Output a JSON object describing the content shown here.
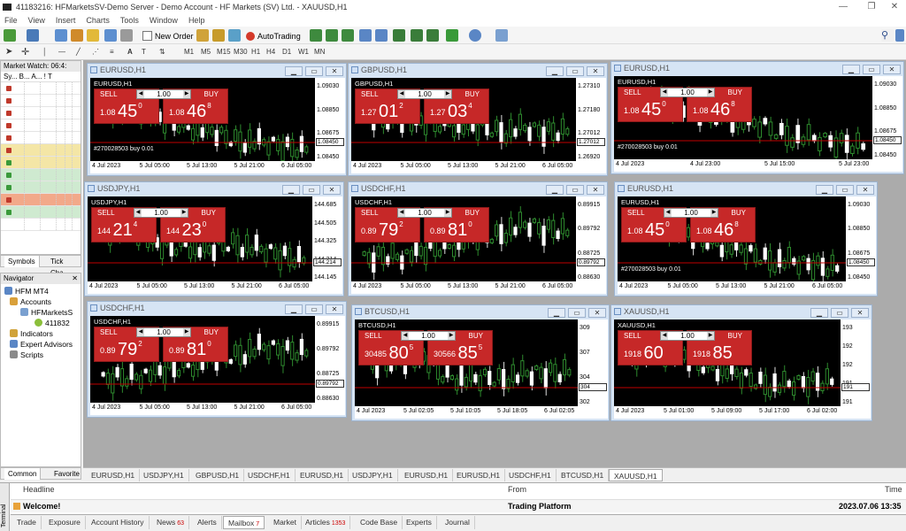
{
  "window": {
    "title": "41183216: HFMarketsSV-Demo Server - Demo Account - HF Markets (SV) Ltd. - XAUUSD,H1"
  },
  "menu": [
    "File",
    "View",
    "Insert",
    "Charts",
    "Tools",
    "Window",
    "Help"
  ],
  "toolbar": {
    "new_order": "New Order",
    "autotrading": "AutoTrading",
    "timeframes": [
      "M1",
      "M5",
      "M15",
      "M30",
      "H1",
      "H4",
      "D1",
      "W1",
      "MN"
    ]
  },
  "market_watch": {
    "title": "Market Watch: 06:4:",
    "columns": "Sy...  B...  A...  !  T",
    "rows": 12,
    "tabs": [
      "Symbols",
      "Tick Cha"
    ]
  },
  "navigator": {
    "title": "Navigator",
    "items": [
      "HFM MT4",
      "Accounts",
      "HFMarketsS",
      "411832",
      "Indicators",
      "Expert Advisors",
      "Scripts"
    ],
    "tabs": [
      "Common",
      "Favorite"
    ]
  },
  "colors": {
    "sell": "#c62828",
    "bg_chart": "#000000",
    "bull": "#2e8b2e",
    "bear": "#ffffff",
    "price_line": "#c00000"
  },
  "charts": [
    {
      "title": "EURUSD,H1",
      "sym": "EURUSD,H1",
      "lot": "1.00",
      "sell_small": "1.08",
      "sell_big": "45",
      "sell_sup": "0",
      "buy_small": "1.08",
      "buy_big": "46",
      "buy_sup": "8",
      "prices": [
        "1.09030",
        "1.08850",
        "1.08675",
        "1.08450"
      ],
      "current": "1.08450",
      "order": "#270028503 buy 0.01",
      "times": [
        "4 Jul 2023",
        "5 Jul 05:00",
        "5 Jul 13:00",
        "5 Jul 21:00",
        "6 Jul 05:00"
      ]
    },
    {
      "title": "GBPUSD,H1",
      "sym": "GBPUSD,H1",
      "lot": "1.00",
      "sell_small": "1.27",
      "sell_big": "01",
      "sell_sup": "2",
      "buy_small": "1.27",
      "buy_big": "03",
      "buy_sup": "4",
      "prices": [
        "1.27310",
        "1.27180",
        "1.27012",
        "1.26920"
      ],
      "current": "1.27012",
      "order": "",
      "times": [
        "4 Jul 2023",
        "5 Jul 05:00",
        "5 Jul 13:00",
        "5 Jul 21:00",
        "6 Jul 05:00"
      ]
    },
    {
      "title": "EURUSD,H1",
      "sym": "EURUSD,H1",
      "lot": "1.00",
      "sell_small": "1.08",
      "sell_big": "45",
      "sell_sup": "0",
      "buy_small": "1.08",
      "buy_big": "46",
      "buy_sup": "8",
      "prices": [
        "1.09030",
        "1.08850",
        "1.08675",
        "1.08450"
      ],
      "current": "1.08450",
      "order": "#270028503 buy 0.01",
      "times": [
        "4 Jul 2023",
        "4 Jul 23:00",
        "5 Jul 15:00",
        "5 Jul 23:00"
      ]
    },
    {
      "title": "USDJPY,H1",
      "sym": "USDJPY,H1",
      "lot": "1.00",
      "sell_small": "144",
      "sell_big": "21",
      "sell_sup": "4",
      "buy_small": "144",
      "buy_big": "23",
      "buy_sup": "0",
      "prices": [
        "144.685",
        "144.505",
        "144.325",
        "144.214",
        "144.145"
      ],
      "current": "144.214",
      "order": "",
      "times": [
        "4 Jul 2023",
        "5 Jul 05:00",
        "5 Jul 13:00",
        "5 Jul 21:00",
        "6 Jul 05:00"
      ]
    },
    {
      "title": "USDCHF,H1",
      "sym": "USDCHF,H1",
      "lot": "1.00",
      "sell_small": "0.89",
      "sell_big": "79",
      "sell_sup": "2",
      "buy_small": "0.89",
      "buy_big": "81",
      "buy_sup": "0",
      "prices": [
        "0.89915",
        "0.89792",
        "0.88725",
        "0.88630"
      ],
      "current": "0.89792",
      "order": "",
      "times": [
        "4 Jul 2023",
        "5 Jul 05:00",
        "5 Jul 13:00",
        "5 Jul 21:00",
        "6 Jul 05:00"
      ]
    },
    {
      "title": "EURUSD,H1",
      "sym": "EURUSD,H1",
      "lot": "1.00",
      "sell_small": "1.08",
      "sell_big": "45",
      "sell_sup": "0",
      "buy_small": "1.08",
      "buy_big": "46",
      "buy_sup": "8",
      "prices": [
        "1.09030",
        "1.08850",
        "1.08675",
        "1.08450"
      ],
      "current": "1.08450",
      "order": "#270028503 buy 0.01",
      "times": [
        "4 Jul 2023",
        "5 Jul 05:00",
        "5 Jul 13:00",
        "5 Jul 21:00",
        "6 Jul 05:00"
      ]
    },
    {
      "title": "USDCHF,H1",
      "sym": "USDCHF,H1",
      "lot": "1.00",
      "sell_small": "0.89",
      "sell_big": "79",
      "sell_sup": "2",
      "buy_small": "0.89",
      "buy_big": "81",
      "buy_sup": "0",
      "prices": [
        "0.89915",
        "0.89792",
        "0.88725",
        "0.88630"
      ],
      "current": "0.89792",
      "order": "",
      "times": [
        "4 Jul 2023",
        "5 Jul 05:00",
        "5 Jul 13:00",
        "5 Jul 21:00",
        "6 Jul 05:00"
      ]
    },
    {
      "title": "BTCUSD,H1",
      "sym": "BTCUSD,H1",
      "lot": "1.00",
      "sell_small": "30485",
      "sell_big": "80",
      "sell_sup": "5",
      "buy_small": "30566",
      "buy_big": "85",
      "buy_sup": "5",
      "prices": [
        "309",
        "307",
        "304",
        "302"
      ],
      "current": "304",
      "order": "",
      "times": [
        "4 Jul 2023",
        "5 Jul 02:05",
        "5 Jul 10:05",
        "5 Jul 18:05",
        "6 Jul 02:05"
      ]
    },
    {
      "title": "XAUUSD,H1",
      "sym": "XAUUSD,H1",
      "lot": "1.00",
      "sell_small": "1918",
      "sell_big": "60",
      "sell_sup": "",
      "buy_small": "1918",
      "buy_big": "85",
      "buy_sup": "",
      "prices": [
        "193",
        "192",
        "192",
        "191",
        "191"
      ],
      "current": "191",
      "order": "",
      "times": [
        "4 Jul 2023",
        "5 Jul 01:00",
        "5 Jul 09:00",
        "5 Jul 17:00",
        "6 Jul 02:00"
      ]
    }
  ],
  "chart_tabs": [
    "EURUSD,H1",
    "USDJPY,H1",
    "GBPUSD,H1",
    "USDCHF,H1",
    "EURUSD,H1",
    "USDJPY,H1",
    "EURUSD,H1",
    "EURUSD,H1",
    "USDCHF,H1",
    "BTCUSD,H1",
    "XAUUSD,H1"
  ],
  "terminal": {
    "label": "Terminal",
    "headers": {
      "headline": "Headline",
      "from": "From",
      "time": "Time"
    },
    "news": {
      "headline": "Welcome!",
      "from": "Trading Platform",
      "time": "2023.07.06 13:35"
    },
    "tabs": [
      {
        "label": "Trade",
        "badge": ""
      },
      {
        "label": "Exposure",
        "badge": ""
      },
      {
        "label": "Account History",
        "badge": ""
      },
      {
        "label": "News",
        "badge": "63"
      },
      {
        "label": "Alerts",
        "badge": ""
      },
      {
        "label": "Mailbox",
        "badge": "7"
      },
      {
        "label": "Market",
        "badge": ""
      },
      {
        "label": "Articles",
        "badge": "1353"
      },
      {
        "label": "Code Base",
        "badge": ""
      },
      {
        "label": "Experts",
        "badge": ""
      },
      {
        "label": "Journal",
        "badge": ""
      }
    ]
  }
}
